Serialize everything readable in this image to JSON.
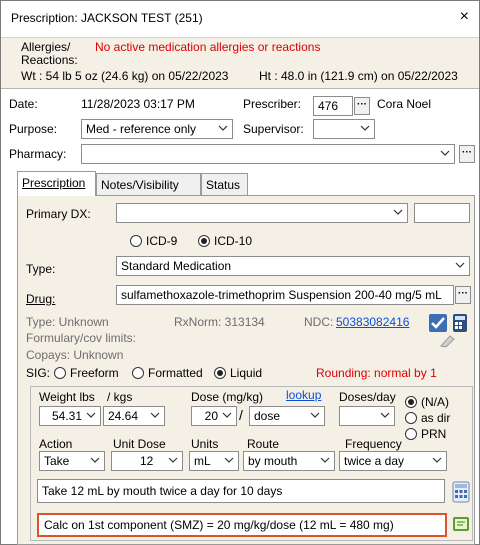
{
  "window": {
    "title": "Prescription: JACKSON TEST (251)",
    "close_glyph": "×"
  },
  "header": {
    "allergies_label": "Allergies/",
    "reactions_label": "Reactions:",
    "allergies_value": "No active medication allergies or reactions",
    "weight_text": "Wt : 54 lb 5 oz (24.6 kg) on 05/22/2023",
    "height_text": "Ht : 48.0 in (121.9 cm) on 05/22/2023"
  },
  "form": {
    "date_label": "Date:",
    "date_value": "11/28/2023 03:17 PM",
    "prescriber_label": "Prescriber:",
    "prescriber_id": "476",
    "prescriber_name": "Cora Noel",
    "purpose_label": "Purpose:",
    "purpose_value": "Med - reference only",
    "supervisor_label": "Supervisor:",
    "supervisor_value": "",
    "pharmacy_label": "Pharmacy:",
    "pharmacy_value": ""
  },
  "tabs": [
    {
      "label": "Prescription",
      "active": true
    },
    {
      "label": "Notes/Visibility",
      "active": false
    },
    {
      "label": "Status",
      "active": false
    }
  ],
  "rx": {
    "primary_dx_label": "Primary DX:",
    "primary_dx_value": "",
    "icd9_label": "ICD-9",
    "icd10_label": "ICD-10",
    "type_label": "Type:",
    "type_value": "Standard Medication",
    "drug_label": "Drug:",
    "drug_value": "sulfamethoxazole-trimethoprim Suspension 200-40 mg/5 mL",
    "type_info": "Type:  Unknown",
    "rxnorm": "RxNorm: 313134",
    "ndc_label": "NDC:",
    "ndc_value": "50383082416",
    "formulary": "Formulary/cov limits:",
    "copays": "Copays:  Unknown",
    "sig_label": "SIG:",
    "sig_options": [
      "Freeform",
      "Formatted",
      "Liquid"
    ],
    "rounding": "Rounding: normal by 1"
  },
  "dose": {
    "weight_lbs_label": "Weight lbs",
    "kgs_label": "/  kgs",
    "lbs_value": "54.31",
    "kgs_value": "24.64",
    "dose_label": "Dose (mg/kg)",
    "lookup_label": "lookup",
    "dose_value": "20",
    "dose_unit": "dose",
    "doses_day_label": "Doses/day",
    "na_label": "(N/A)",
    "asdir_label": "as dir",
    "prn_label": "PRN",
    "action_label": "Action",
    "unit_dose_label": "Unit Dose",
    "units_label": "Units",
    "route_label": "Route",
    "frequency_label": "Frequency",
    "action_value": "Take",
    "unit_dose_value": "12",
    "units_value": "mL",
    "route_value": "by mouth",
    "frequency_value": "twice a day",
    "sig_text": "Take 12 mL by mouth twice a day for 10 days",
    "calc_text": "Calc on 1st component (SMZ) = 20 mg/kg/dose (12 mL = 480 mg)"
  }
}
